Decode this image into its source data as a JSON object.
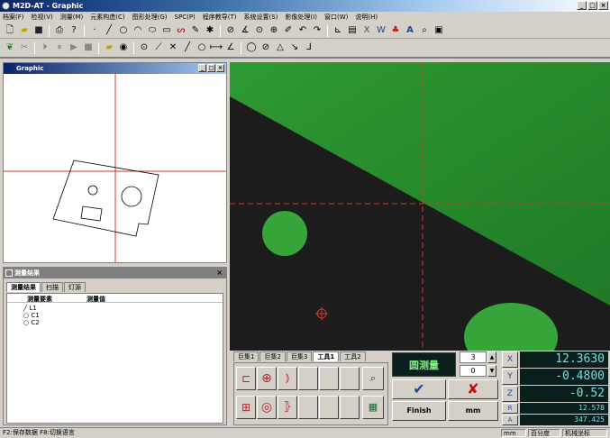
{
  "window": {
    "title": "M2D-AT - Graphic"
  },
  "menu": [
    "档案(F)",
    "检视(V)",
    "测量(M)",
    "元素构造(C)",
    "图形处理(G)",
    "SPC(P)",
    "程序教导(T)",
    "系统设置(S)",
    "影像处理(I)",
    "窗口(W)",
    "说明(H)"
  ],
  "graphic_window": {
    "title": "Graphic"
  },
  "results_window": {
    "title": "测量结果",
    "tabs": [
      "测量结果",
      "扫描",
      "灯源"
    ],
    "columns": [
      "测量要素",
      "测量值"
    ],
    "items": [
      "L1",
      "C1",
      "C2"
    ]
  },
  "tool_tabs": [
    "巨集1",
    "巨集2",
    "巨集3",
    "工具1",
    "工具2"
  ],
  "measure": {
    "mode_label": "圆测量",
    "count_top": "3",
    "count_bottom": "0",
    "finish_label": "Finish",
    "unit_label": "mm"
  },
  "dro": [
    {
      "axis": "X",
      "value": "12.3630"
    },
    {
      "axis": "Y",
      "value": "-0.4800"
    },
    {
      "axis": "Z",
      "value": "-0.52"
    },
    {
      "axis": "R",
      "value": "12.578"
    },
    {
      "axis": "A",
      "value": "347.425"
    }
  ],
  "status": {
    "left": "F2:保存数据 F8:切换语言",
    "unit": "mm",
    "angle": "百分度",
    "coord": "机械坐标"
  },
  "colors": {
    "green": "#36a53a",
    "dark": "#1c1c1c",
    "crosshair": "#d23a2a"
  }
}
